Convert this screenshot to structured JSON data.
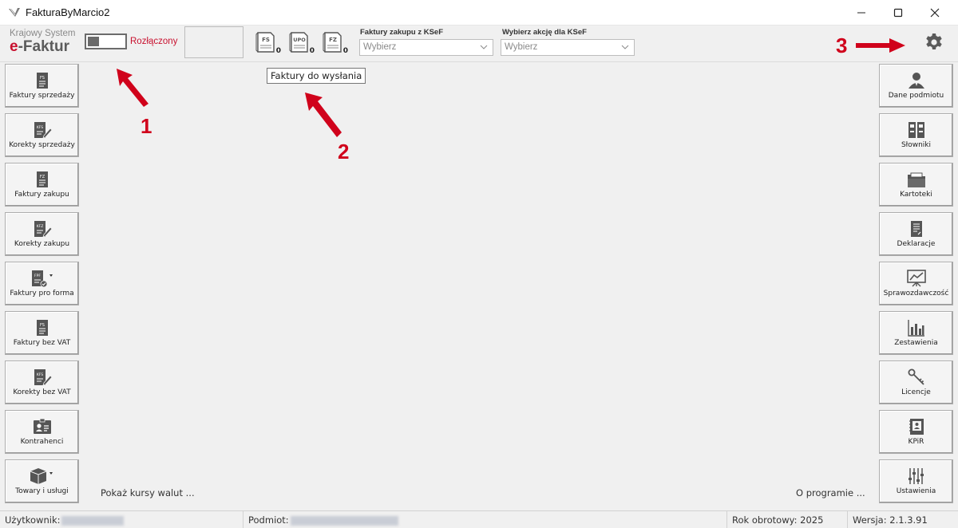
{
  "window": {
    "title": "FakturaByMarcio2"
  },
  "header": {
    "logo_line1": "Krajowy System",
    "logo_e": "e",
    "logo_rest": "-Faktur",
    "connection_status": "Rozłączony",
    "counters": [
      {
        "icon": "fs-document-icon",
        "code": "FS",
        "count": "0"
      },
      {
        "icon": "upo-document-icon",
        "code": "UPO",
        "count": "0"
      },
      {
        "icon": "fz-document-icon",
        "code": "FZ",
        "count": "0"
      }
    ],
    "purchase_label": "Faktury zakupu z KSeF",
    "purchase_value": "Wybierz",
    "action_label": "Wybierz akcję dla KSeF",
    "action_value": "Wybierz"
  },
  "tooltip": "Faktury do wysłania",
  "left_buttons": [
    {
      "label": "Faktury sprzedaży",
      "icon": "fs-document-icon"
    },
    {
      "label": "Korekty sprzedaży",
      "icon": "sales-correction-icon"
    },
    {
      "label": "Faktury zakupu",
      "icon": "fz-document-icon"
    },
    {
      "label": "Korekty zakupu",
      "icon": "purchase-correction-icon"
    },
    {
      "label": "Faktury pro forma",
      "icon": "proforma-icon"
    },
    {
      "label": "Faktury bez VAT",
      "icon": "no-vat-document-icon"
    },
    {
      "label": "Korekty bez VAT",
      "icon": "no-vat-correction-icon"
    },
    {
      "label": "Kontrahenci",
      "icon": "contact-card-icon"
    },
    {
      "label": "Towary i usługi",
      "icon": "package-icon"
    }
  ],
  "right_buttons": [
    {
      "label": "Dane podmiotu",
      "icon": "person-icon"
    },
    {
      "label": "Słowniki",
      "icon": "binders-icon"
    },
    {
      "label": "Kartoteki",
      "icon": "folder-icon"
    },
    {
      "label": "Deklaracje",
      "icon": "declaration-icon"
    },
    {
      "label": "Sprawozdawczość",
      "icon": "presentation-chart-icon"
    },
    {
      "label": "Zestawienia",
      "icon": "bar-chart-icon"
    },
    {
      "label": "Licencje",
      "icon": "key-icon"
    },
    {
      "label": "KPiR",
      "icon": "ledger-book-icon"
    },
    {
      "label": "Ustawienia",
      "icon": "sliders-icon"
    }
  ],
  "links": {
    "rates": "Pokaż kursy walut ...",
    "about": "O programie ..."
  },
  "status": {
    "user_label": "Użytkownik:",
    "entity_label": "Podmiot:",
    "fiscal_year": "Rok obrotowy: 2025",
    "version": "Wersja: 2.1.3.91"
  },
  "annotations": [
    "1",
    "2",
    "3"
  ],
  "colors": {
    "accent_red": "#c8102e",
    "annotation_red": "#d0021b"
  }
}
